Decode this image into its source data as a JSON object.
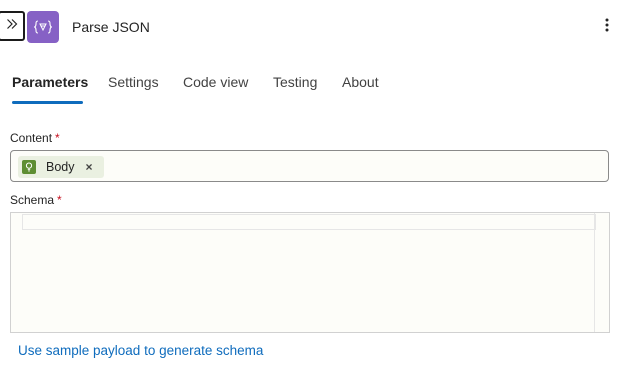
{
  "header": {
    "title": "Parse JSON",
    "icon": "parse-json-icon",
    "collapse_icon": "double-chevron-right-icon",
    "more_icon": "more-vertical-icon",
    "accent_color": "#8661c5"
  },
  "tabs": [
    {
      "label": "Parameters",
      "active": true
    },
    {
      "label": "Settings",
      "active": false
    },
    {
      "label": "Code view",
      "active": false
    },
    {
      "label": "Testing",
      "active": false
    },
    {
      "label": "About",
      "active": false
    }
  ],
  "content_field": {
    "label": "Content",
    "required_mark": "*",
    "token": {
      "label": "Body",
      "icon": "bulb-icon",
      "remove_label": "×",
      "color": "#5e8e32"
    }
  },
  "schema_field": {
    "label": "Schema",
    "required_mark": "*",
    "value": ""
  },
  "sample_link": "Use sample payload to generate schema",
  "colors": {
    "link": "#0f6cbd",
    "required": "#c50f1f",
    "tab_underline": "#0f6cbd"
  }
}
